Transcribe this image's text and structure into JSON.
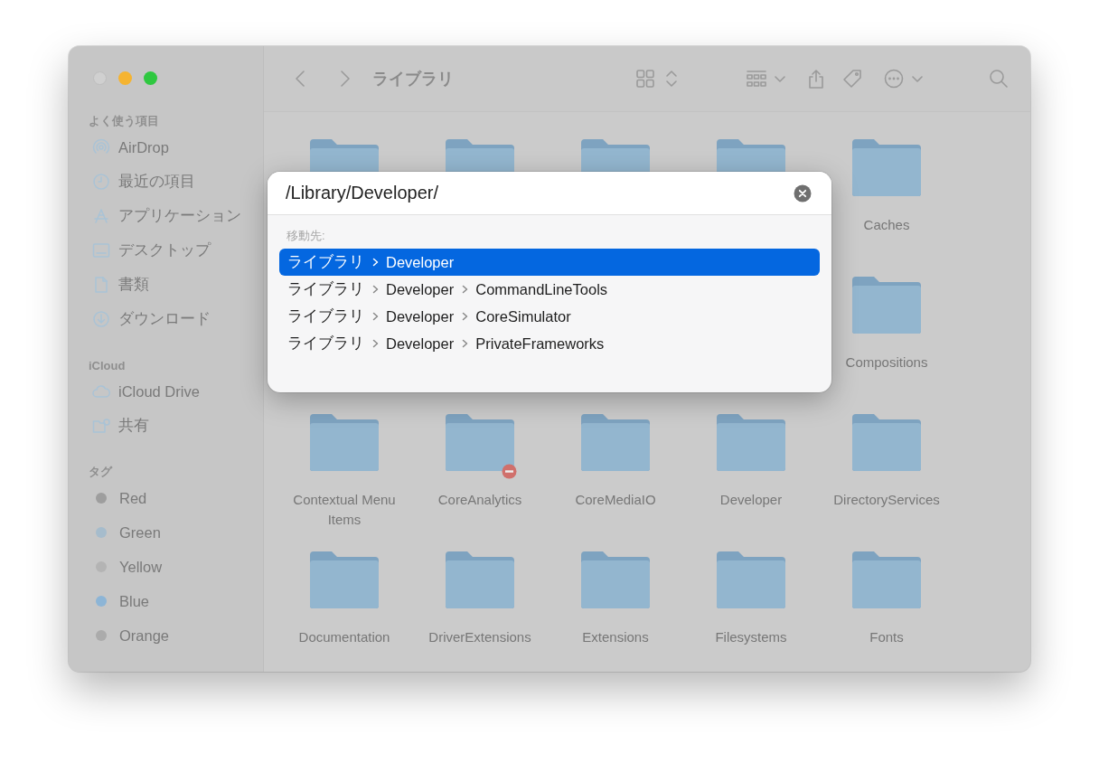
{
  "window": {
    "title": "ライブラリ"
  },
  "sidebar": {
    "sections": [
      {
        "header": "よく使う項目",
        "items": [
          {
            "kind": "airdrop",
            "label": "AirDrop"
          },
          {
            "kind": "clock",
            "label": "最近の項目"
          },
          {
            "kind": "apps",
            "label": "アプリケーション"
          },
          {
            "kind": "desktop",
            "label": "デスクトップ"
          },
          {
            "kind": "document",
            "label": "書類"
          },
          {
            "kind": "download",
            "label": "ダウンロード"
          }
        ]
      },
      {
        "header": "iCloud",
        "items": [
          {
            "kind": "cloud",
            "label": "iCloud Drive"
          },
          {
            "kind": "shared",
            "label": "共有"
          }
        ]
      },
      {
        "header": "タグ",
        "items": [
          {
            "kind": "tag",
            "label": "Red",
            "color": "#9e9e9e"
          },
          {
            "kind": "tag",
            "label": "Green",
            "color": "#a6bccc"
          },
          {
            "kind": "tag",
            "label": "Yellow",
            "color": "#b4b4b4"
          },
          {
            "kind": "tag",
            "label": "Blue",
            "color": "#8db5d6"
          },
          {
            "kind": "tag",
            "label": "Orange",
            "color": "#ababab"
          }
        ]
      }
    ]
  },
  "folders": [
    [
      {
        "label": "Caches",
        "restricted": false
      }
    ],
    [
      {
        "label": "Compositions",
        "restricted": false
      }
    ],
    [
      {
        "label": "Contextual Menu Items",
        "restricted": false
      },
      {
        "label": "CoreAnalytics",
        "restricted": true
      },
      {
        "label": "CoreMediaIO",
        "restricted": false
      },
      {
        "label": "Developer",
        "restricted": false
      },
      {
        "label": "DirectoryServices",
        "restricted": false
      }
    ],
    [
      {
        "label": "Documentation",
        "restricted": false
      },
      {
        "label": "DriverExtensions",
        "restricted": false
      },
      {
        "label": "Extensions",
        "restricted": false
      },
      {
        "label": "Filesystems",
        "restricted": false
      },
      {
        "label": "Fonts",
        "restricted": false
      }
    ]
  ],
  "go_to_folder": {
    "value": "/Library/Developer/",
    "section_label": "移動先:",
    "results": [
      {
        "path": [
          "ライブラリ",
          "Developer"
        ],
        "selected": true
      },
      {
        "path": [
          "ライブラリ",
          "Developer",
          "CommandLineTools"
        ],
        "selected": false
      },
      {
        "path": [
          "ライブラリ",
          "Developer",
          "CoreSimulator"
        ],
        "selected": false
      },
      {
        "path": [
          "ライブラリ",
          "Developer",
          "PrivateFrameworks"
        ],
        "selected": false
      }
    ]
  }
}
